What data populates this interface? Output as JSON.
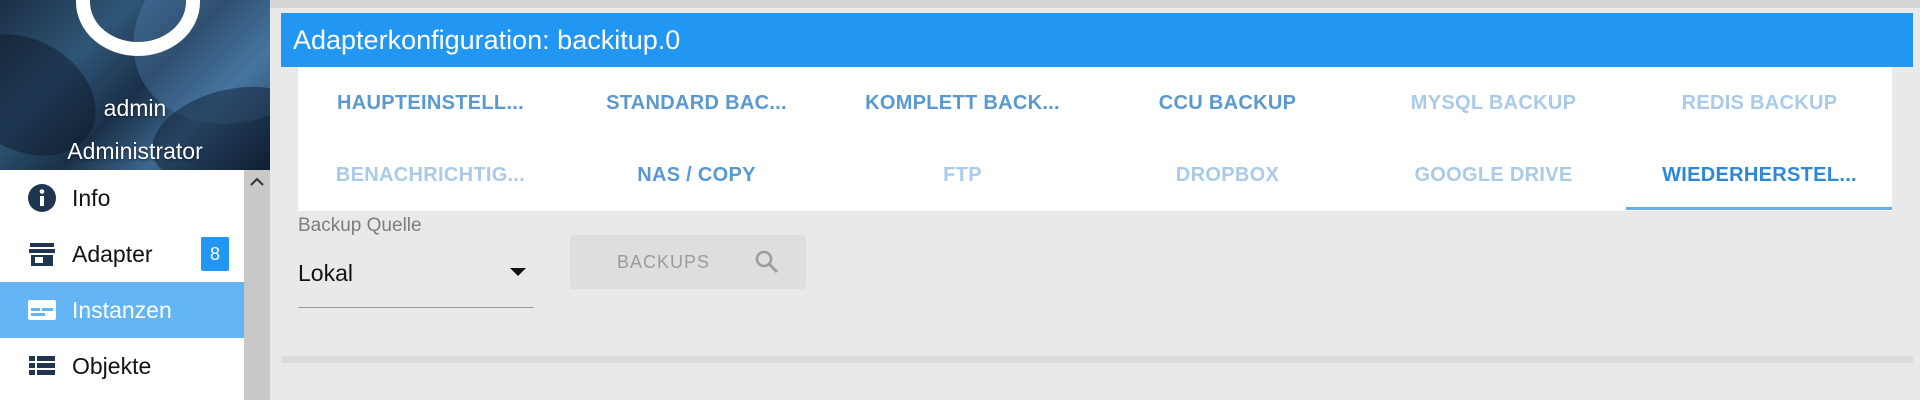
{
  "user": {
    "name": "admin",
    "role": "Administrator"
  },
  "nav": {
    "items": [
      {
        "label": "Info",
        "icon": "info-icon",
        "active": false
      },
      {
        "label": "Adapter",
        "icon": "store-icon",
        "badge": "8",
        "active": false
      },
      {
        "label": "Instanzen",
        "icon": "instances-icon",
        "active": true
      },
      {
        "label": "Objekte",
        "icon": "list-icon",
        "active": false
      }
    ]
  },
  "dialog": {
    "title": "Adapterkonfiguration: backitup.0"
  },
  "tabs": [
    {
      "label": "HAUPTEINSTELL...",
      "state": "normal"
    },
    {
      "label": "STANDARD BAC...",
      "state": "normal"
    },
    {
      "label": "KOMPLETT BACK...",
      "state": "normal"
    },
    {
      "label": "CCU BACKUP",
      "state": "normal"
    },
    {
      "label": "MYSQL BACKUP",
      "state": "faded"
    },
    {
      "label": "REDIS BACKUP",
      "state": "faded"
    },
    {
      "label": "BENACHRICHTIG...",
      "state": "faded"
    },
    {
      "label": "NAS / COPY",
      "state": "normal"
    },
    {
      "label": "FTP",
      "state": "faded"
    },
    {
      "label": "DROPBOX",
      "state": "faded"
    },
    {
      "label": "GOOGLE DRIVE",
      "state": "faded"
    },
    {
      "label": "WIEDERHERSTEL...",
      "state": "selected"
    }
  ],
  "restore": {
    "source_label": "Backup Quelle",
    "source_value": "Lokal",
    "backups_button": "BACKUPS"
  },
  "colors": {
    "accent": "#2196f3",
    "active_nav": "#64b5f6",
    "tab_text": "#5a98d0",
    "tab_text_disabled": "#a9cae8"
  }
}
